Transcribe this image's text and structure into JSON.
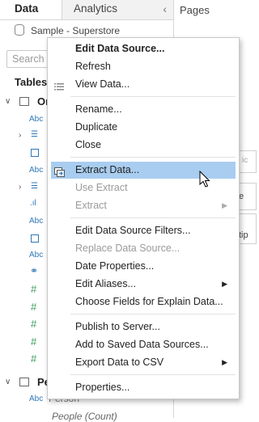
{
  "tabs": {
    "data": "Data",
    "analytics": "Analytics"
  },
  "pages_label": "Pages",
  "data_source": "Sample - Superstore",
  "search_placeholder": "Search",
  "tables_heading": "Tables",
  "tree": {
    "orders_prefix": "Or",
    "people_prefix": "Pe",
    "type_abc": "Abc",
    "type_num": "#",
    "person_field": "Person",
    "people_count": "People (Count)"
  },
  "right_panel": {
    "partial_1": "ic",
    "partial_2": "e",
    "partial_3": "tip"
  },
  "menu": {
    "items": [
      {
        "label": "Edit Data Source...",
        "bold": true
      },
      {
        "label": "Refresh"
      },
      {
        "label": "View Data..."
      },
      {
        "label": "Rename..."
      },
      {
        "label": "Duplicate"
      },
      {
        "label": "Close"
      },
      {
        "label": "Extract Data...",
        "highlighted": true
      },
      {
        "label": "Use Extract",
        "disabled": true
      },
      {
        "label": "Extract",
        "disabled": true,
        "submenu": true
      },
      {
        "label": "Edit Data Source Filters..."
      },
      {
        "label": "Replace Data Source...",
        "disabled": true
      },
      {
        "label": "Date Properties..."
      },
      {
        "label": "Edit Aliases...",
        "submenu": true
      },
      {
        "label": "Choose Fields for Explain Data..."
      },
      {
        "label": "Publish to Server..."
      },
      {
        "label": "Add to Saved Data Sources..."
      },
      {
        "label": "Export Data to CSV",
        "submenu": true
      },
      {
        "label": "Properties..."
      }
    ]
  },
  "colors": {
    "highlight": "#a9cdf0",
    "disabled_text": "#9a9a9a",
    "dimension_blue": "#2f77b8",
    "measure_green": "#3b9b5f"
  }
}
